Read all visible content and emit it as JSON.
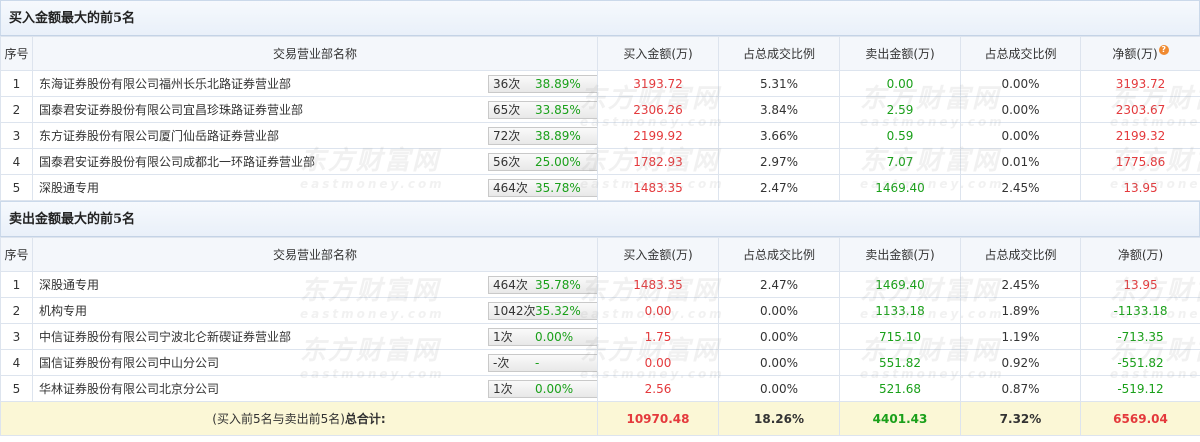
{
  "buy": {
    "title": "买入金额最大的前5名",
    "headers": [
      "序号",
      "交易营业部名称",
      "买入金额(万)",
      "占总成交比例",
      "卖出金额(万)",
      "占总成交比例",
      "净额(万)"
    ],
    "rows": [
      {
        "idx": "1",
        "name": "东海证券股份有限公司福州长乐北路证券营业部",
        "count": "36次",
        "pct": "38.89%",
        "action": "help",
        "buy": "3193.72",
        "buy_ratio": "5.31%",
        "sell": "0.00",
        "sell_ratio": "0.00%",
        "net": "3193.72"
      },
      {
        "idx": "2",
        "name": "国泰君安证券股份有限公司宜昌珍珠路证券营业部",
        "count": "65次",
        "pct": "33.85%",
        "action": "arrow",
        "buy": "2306.26",
        "buy_ratio": "3.84%",
        "sell": "2.59",
        "sell_ratio": "0.00%",
        "net": "2303.67"
      },
      {
        "idx": "3",
        "name": "东方证券股份有限公司厦门仙岳路证券营业部",
        "count": "72次",
        "pct": "38.89%",
        "action": "arrow",
        "buy": "2199.92",
        "buy_ratio": "3.66%",
        "sell": "0.59",
        "sell_ratio": "0.00%",
        "net": "2199.32"
      },
      {
        "idx": "4",
        "name": "国泰君安证券股份有限公司成都北一环路证券营业部",
        "count": "56次",
        "pct": "25.00%",
        "action": "arrow",
        "buy": "1782.93",
        "buy_ratio": "2.97%",
        "sell": "7.07",
        "sell_ratio": "0.01%",
        "net": "1775.86"
      },
      {
        "idx": "5",
        "name": "深股通专用",
        "count": "464次",
        "pct": "35.78%",
        "action": "arrow",
        "buy": "1483.35",
        "buy_ratio": "2.47%",
        "sell": "1469.40",
        "sell_ratio": "2.45%",
        "net": "13.95"
      }
    ]
  },
  "sell": {
    "title": "卖出金额最大的前5名",
    "headers": [
      "序号",
      "交易营业部名称",
      "买入金额(万)",
      "占总成交比例",
      "卖出金额(万)",
      "占总成交比例",
      "净额(万)"
    ],
    "rows": [
      {
        "idx": "1",
        "name": "深股通专用",
        "count": "464次",
        "pct": "35.78%",
        "action": "help",
        "buy": "1483.35",
        "buy_ratio": "2.47%",
        "sell": "1469.40",
        "sell_ratio": "2.45%",
        "net": "13.95"
      },
      {
        "idx": "2",
        "name": "机构专用",
        "count": "1042次",
        "pct": "35.32%",
        "action": "arrow",
        "buy": "0.00",
        "buy_ratio": "0.00%",
        "sell": "1133.18",
        "sell_ratio": "1.89%",
        "net": "-1133.18"
      },
      {
        "idx": "3",
        "name": "中信证券股份有限公司宁波北仑新碶证券营业部",
        "count": "1次",
        "pct": "0.00%",
        "action": "arrow",
        "buy": "1.75",
        "buy_ratio": "0.00%",
        "sell": "715.10",
        "sell_ratio": "1.19%",
        "net": "-713.35"
      },
      {
        "idx": "4",
        "name": "国信证券股份有限公司中山分公司",
        "count": "-次",
        "pct": "-",
        "action": "arrow",
        "buy": "0.00",
        "buy_ratio": "0.00%",
        "sell": "551.82",
        "sell_ratio": "0.92%",
        "net": "-551.82"
      },
      {
        "idx": "5",
        "name": "华林证券股份有限公司北京分公司",
        "count": "1次",
        "pct": "0.00%",
        "action": "arrow",
        "buy": "2.56",
        "buy_ratio": "0.00%",
        "sell": "521.68",
        "sell_ratio": "0.87%",
        "net": "-519.12"
      }
    ],
    "total": {
      "label_prefix": "(买入前5名与卖出前5名)",
      "label_bold": "总合计:",
      "buy": "10970.48",
      "buy_ratio": "18.26%",
      "sell": "4401.43",
      "sell_ratio": "7.32%",
      "net": "6569.04"
    }
  },
  "icons": {
    "help": "question-icon",
    "arrow": "play-arrow-icon"
  },
  "colors": {
    "positive": "#e4393c",
    "negative": "#1aa01a",
    "total_bg": "#fbf7d6",
    "header_bg": "#f4f7fb"
  },
  "watermark": {
    "cn": "东方财富网",
    "en": "eastmoney.com"
  }
}
